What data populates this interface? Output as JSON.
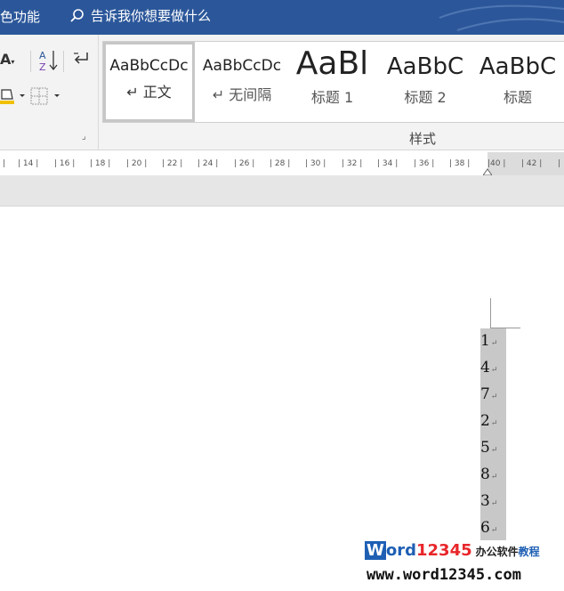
{
  "topbar": {
    "tab_partial": "色功能",
    "tellme_text": "告诉我你想要做什么"
  },
  "ribbon": {
    "paragraph_icons": [
      "font-size-icon",
      "sort-icon",
      "paragraph-mark-icon",
      "shading-icon",
      "borders-icon"
    ],
    "styles_group_label": "样式",
    "styles": [
      {
        "sample": "AaBbCcDc",
        "label": "↵ 正文",
        "selected": true
      },
      {
        "sample": "AaBbCcDc",
        "label": "↵ 无间隔",
        "selected": false
      },
      {
        "sample": "AaBl",
        "label": "标题 1",
        "selected": false
      },
      {
        "sample": "AaBbC",
        "label": "标题 2",
        "selected": false
      },
      {
        "sample": "AaBbC",
        "label": "标题",
        "selected": false
      }
    ]
  },
  "ruler": {
    "ticks": [
      "|",
      "| 14 |",
      "| 16 |",
      "| 18 |",
      "| 20 |",
      "| 22 |",
      "| 24 |",
      "| 26 |",
      "| 28 |",
      "| 30 |",
      "| 32 |",
      "| 34 |",
      "| 36 |",
      "| 38 |",
      "|40 |",
      "| 42 |",
      "|"
    ]
  },
  "document": {
    "lines": [
      {
        "text": "1",
        "mark": "↵"
      },
      {
        "text": "4",
        "mark": "↵"
      },
      {
        "text": "7",
        "mark": "↵"
      },
      {
        "text": "2",
        "mark": "↵"
      },
      {
        "text": "5",
        "mark": "↵"
      },
      {
        "text": "8",
        "mark": "↵"
      },
      {
        "text": "3",
        "mark": "↵"
      },
      {
        "text": "6",
        "mark": "↵"
      }
    ]
  },
  "watermark": {
    "w": "W",
    "ord": "ord",
    "digits": "12345",
    "cn1": "办公软件",
    "cn2": "教程",
    "url": "www.word12345.com"
  },
  "colors": {
    "title_bar": "#2b579a",
    "ribbon_bg": "#f3f3f3",
    "selection": "#c8c8c8"
  }
}
